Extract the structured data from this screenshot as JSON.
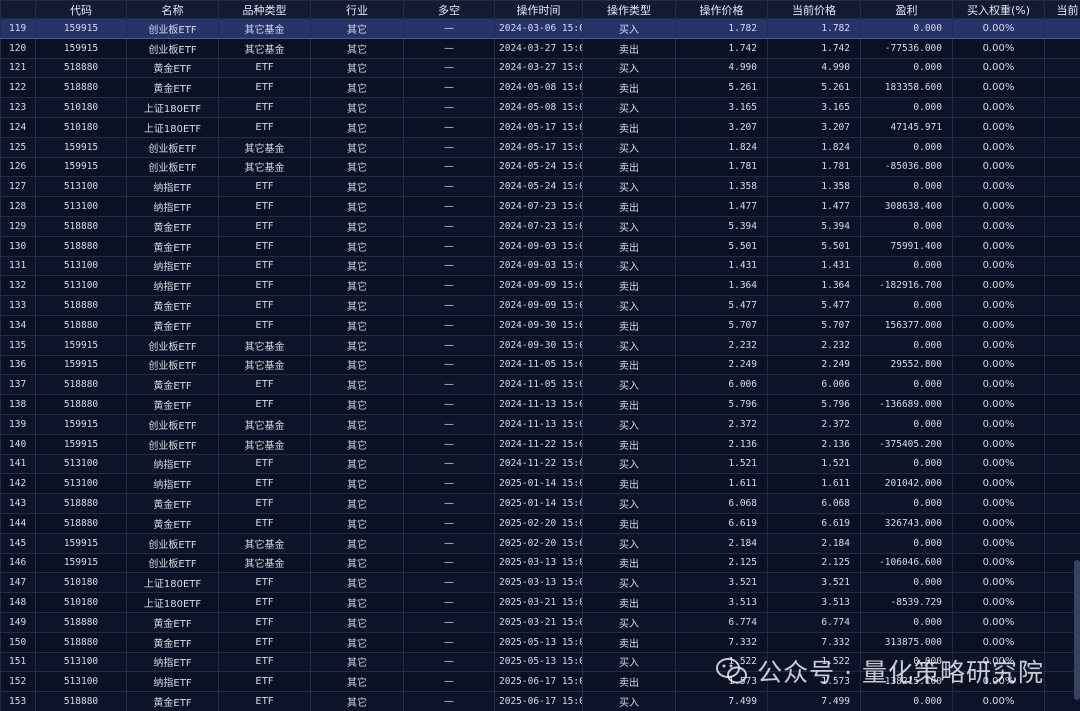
{
  "headers": [
    "",
    "代码",
    "名称",
    "品种类型",
    "行业",
    "多空",
    "操作时间",
    "操作类型",
    "操作价格",
    "当前价格",
    "盈利",
    "买入权重(%)",
    "当前"
  ],
  "rows": [
    [
      "119",
      "159915",
      "创业板ETF",
      "其它基金",
      "其它",
      "—",
      "2024-03-06 15:0",
      "买入",
      "1.782",
      "1.782",
      "0.000",
      "0.00%",
      ""
    ],
    [
      "120",
      "159915",
      "创业板ETF",
      "其它基金",
      "其它",
      "—",
      "2024-03-27 15:0",
      "卖出",
      "1.742",
      "1.742",
      "-77536.000",
      "0.00%",
      ""
    ],
    [
      "121",
      "518880",
      "黄金ETF",
      "ETF",
      "其它",
      "—",
      "2024-03-27 15:0",
      "买入",
      "4.990",
      "4.990",
      "0.000",
      "0.00%",
      ""
    ],
    [
      "122",
      "518880",
      "黄金ETF",
      "ETF",
      "其它",
      "—",
      "2024-05-08 15:0",
      "卖出",
      "5.261",
      "5.261",
      "183358.600",
      "0.00%",
      ""
    ],
    [
      "123",
      "510180",
      "上证180ETF",
      "ETF",
      "其它",
      "—",
      "2024-05-08 15:0",
      "买入",
      "3.165",
      "3.165",
      "0.000",
      "0.00%",
      ""
    ],
    [
      "124",
      "510180",
      "上证180ETF",
      "ETF",
      "其它",
      "—",
      "2024-05-17 15:0",
      "卖出",
      "3.207",
      "3.207",
      "47145.971",
      "0.00%",
      ""
    ],
    [
      "125",
      "159915",
      "创业板ETF",
      "其它基金",
      "其它",
      "—",
      "2024-05-17 15:0",
      "买入",
      "1.824",
      "1.824",
      "0.000",
      "0.00%",
      ""
    ],
    [
      "126",
      "159915",
      "创业板ETF",
      "其它基金",
      "其它",
      "—",
      "2024-05-24 15:0",
      "卖出",
      "1.781",
      "1.781",
      "-85036.800",
      "0.00%",
      ""
    ],
    [
      "127",
      "513100",
      "纳指ETF",
      "ETF",
      "其它",
      "—",
      "2024-05-24 15:0",
      "买入",
      "1.358",
      "1.358",
      "0.000",
      "0.00%",
      ""
    ],
    [
      "128",
      "513100",
      "纳指ETF",
      "ETF",
      "其它",
      "—",
      "2024-07-23 15:0",
      "卖出",
      "1.477",
      "1.477",
      "308638.400",
      "0.00%",
      ""
    ],
    [
      "129",
      "518880",
      "黄金ETF",
      "ETF",
      "其它",
      "—",
      "2024-07-23 15:0",
      "买入",
      "5.394",
      "5.394",
      "0.000",
      "0.00%",
      ""
    ],
    [
      "130",
      "518880",
      "黄金ETF",
      "ETF",
      "其它",
      "—",
      "2024-09-03 15:0",
      "卖出",
      "5.501",
      "5.501",
      "75991.400",
      "0.00%",
      ""
    ],
    [
      "131",
      "513100",
      "纳指ETF",
      "ETF",
      "其它",
      "—",
      "2024-09-03 15:0",
      "买入",
      "1.431",
      "1.431",
      "0.000",
      "0.00%",
      ""
    ],
    [
      "132",
      "513100",
      "纳指ETF",
      "ETF",
      "其它",
      "—",
      "2024-09-09 15:0",
      "卖出",
      "1.364",
      "1.364",
      "-182916.700",
      "0.00%",
      ""
    ],
    [
      "133",
      "518880",
      "黄金ETF",
      "ETF",
      "其它",
      "—",
      "2024-09-09 15:0",
      "买入",
      "5.477",
      "5.477",
      "0.000",
      "0.00%",
      ""
    ],
    [
      "134",
      "518880",
      "黄金ETF",
      "ETF",
      "其它",
      "—",
      "2024-09-30 15:0",
      "卖出",
      "5.707",
      "5.707",
      "156377.000",
      "0.00%",
      ""
    ],
    [
      "135",
      "159915",
      "创业板ETF",
      "其它基金",
      "其它",
      "—",
      "2024-09-30 15:0",
      "买入",
      "2.232",
      "2.232",
      "0.000",
      "0.00%",
      ""
    ],
    [
      "136",
      "159915",
      "创业板ETF",
      "其它基金",
      "其它",
      "—",
      "2024-11-05 15:0",
      "卖出",
      "2.249",
      "2.249",
      "29552.800",
      "0.00%",
      ""
    ],
    [
      "137",
      "518880",
      "黄金ETF",
      "ETF",
      "其它",
      "—",
      "2024-11-05 15:0",
      "买入",
      "6.006",
      "6.006",
      "0.000",
      "0.00%",
      ""
    ],
    [
      "138",
      "518880",
      "黄金ETF",
      "ETF",
      "其它",
      "—",
      "2024-11-13 15:0",
      "卖出",
      "5.796",
      "5.796",
      "-136689.000",
      "0.00%",
      ""
    ],
    [
      "139",
      "159915",
      "创业板ETF",
      "其它基金",
      "其它",
      "—",
      "2024-11-13 15:0",
      "买入",
      "2.372",
      "2.372",
      "0.000",
      "0.00%",
      ""
    ],
    [
      "140",
      "159915",
      "创业板ETF",
      "其它基金",
      "其它",
      "—",
      "2024-11-22 15:0",
      "卖出",
      "2.136",
      "2.136",
      "-375405.200",
      "0.00%",
      ""
    ],
    [
      "141",
      "513100",
      "纳指ETF",
      "ETF",
      "其它",
      "—",
      "2024-11-22 15:0",
      "买入",
      "1.521",
      "1.521",
      "0.000",
      "0.00%",
      ""
    ],
    [
      "142",
      "513100",
      "纳指ETF",
      "ETF",
      "其它",
      "—",
      "2025-01-14 15:0",
      "卖出",
      "1.611",
      "1.611",
      "201042.000",
      "0.00%",
      ""
    ],
    [
      "143",
      "518880",
      "黄金ETF",
      "ETF",
      "其它",
      "—",
      "2025-01-14 15:0",
      "买入",
      "6.068",
      "6.068",
      "0.000",
      "0.00%",
      ""
    ],
    [
      "144",
      "518880",
      "黄金ETF",
      "ETF",
      "其它",
      "—",
      "2025-02-20 15:0",
      "卖出",
      "6.619",
      "6.619",
      "326743.000",
      "0.00%",
      ""
    ],
    [
      "145",
      "159915",
      "创业板ETF",
      "其它基金",
      "其它",
      "—",
      "2025-02-20 15:0",
      "买入",
      "2.184",
      "2.184",
      "0.000",
      "0.00%",
      ""
    ],
    [
      "146",
      "159915",
      "创业板ETF",
      "其它基金",
      "其它",
      "—",
      "2025-03-13 15:0",
      "卖出",
      "2.125",
      "2.125",
      "-106046.600",
      "0.00%",
      ""
    ],
    [
      "147",
      "510180",
      "上证180ETF",
      "ETF",
      "其它",
      "—",
      "2025-03-13 15:0",
      "买入",
      "3.521",
      "3.521",
      "0.000",
      "0.00%",
      ""
    ],
    [
      "148",
      "510180",
      "上证180ETF",
      "ETF",
      "其它",
      "—",
      "2025-03-21 15:0",
      "卖出",
      "3.513",
      "3.513",
      "-8539.729",
      "0.00%",
      ""
    ],
    [
      "149",
      "518880",
      "黄金ETF",
      "ETF",
      "其它",
      "—",
      "2025-03-21 15:0",
      "买入",
      "6.774",
      "6.774",
      "0.000",
      "0.00%",
      ""
    ],
    [
      "150",
      "518880",
      "黄金ETF",
      "ETF",
      "其它",
      "—",
      "2025-05-13 15:0",
      "卖出",
      "7.332",
      "7.332",
      "313875.000",
      "0.00%",
      ""
    ],
    [
      "151",
      "513100",
      "纳指ETF",
      "ETF",
      "其它",
      "—",
      "2025-05-13 15:0",
      "买入",
      "1.522",
      "1.522",
      "0.000",
      "0.00%",
      ""
    ],
    [
      "152",
      "513100",
      "纳指ETF",
      "ETF",
      "其它",
      "—",
      "2025-06-17 15:0",
      "卖出",
      "1.573",
      "1.573",
      "138215.100",
      "0.00%",
      ""
    ],
    [
      "153",
      "518880",
      "黄金ETF",
      "ETF",
      "其它",
      "—",
      "2025-06-17 15:0",
      "买入",
      "7.499",
      "7.499",
      "0.000",
      "0.00%",
      ""
    ]
  ],
  "selected_row": "119",
  "watermark": {
    "text": "公众号 · 量化策略研究院",
    "icon": "wechat-icon"
  },
  "colors": {
    "background": "#0b1124",
    "header": "#131a33",
    "selected": "#27346a",
    "grid": "#232b45",
    "text": "#d7dbe6"
  }
}
